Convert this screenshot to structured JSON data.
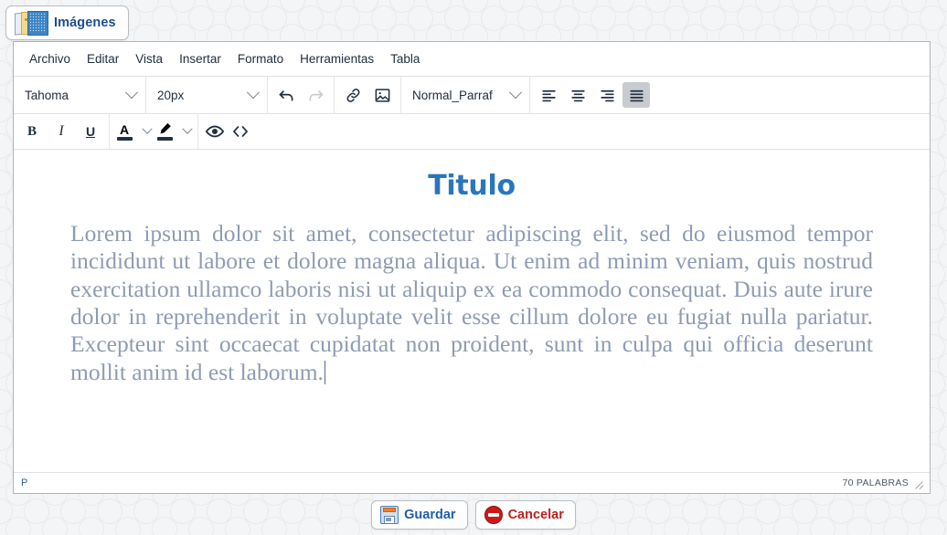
{
  "tab": {
    "label": "Imágenes",
    "icon": "images-stack-icon"
  },
  "menubar": {
    "items": [
      {
        "label": "Archivo"
      },
      {
        "label": "Editar"
      },
      {
        "label": "Vista"
      },
      {
        "label": "Insertar"
      },
      {
        "label": "Formato"
      },
      {
        "label": "Herramientas"
      },
      {
        "label": "Tabla"
      }
    ]
  },
  "toolbar1": {
    "font_family": {
      "value": "Tahoma",
      "icon": "chevron-down-icon"
    },
    "font_size": {
      "value": "20px",
      "icon": "chevron-down-icon"
    },
    "undo": {
      "label": "Deshacer",
      "icon": "undo-icon",
      "state": "enabled"
    },
    "redo": {
      "label": "Rehacer",
      "icon": "redo-icon",
      "state": "disabled"
    },
    "link": {
      "label": "Insertar enlace",
      "icon": "link-icon"
    },
    "image": {
      "label": "Insertar imagen",
      "icon": "image-icon"
    },
    "paragraph_style": {
      "value": "Normal_Parraf",
      "icon": "chevron-down-icon"
    },
    "align_left": {
      "label": "Alinear a la izquierda",
      "icon": "align-left-icon",
      "active": false
    },
    "align_center": {
      "label": "Centrar",
      "icon": "align-center-icon",
      "active": false
    },
    "align_right": {
      "label": "Alinear a la derecha",
      "icon": "align-right-icon",
      "active": false
    },
    "align_justify": {
      "label": "Justificar",
      "icon": "align-justify-icon",
      "active": true
    }
  },
  "toolbar2": {
    "bold": {
      "label": "B",
      "icon": "bold-icon"
    },
    "italic": {
      "label": "I",
      "icon": "italic-icon"
    },
    "underline": {
      "label": "U",
      "icon": "underline-icon"
    },
    "text_color": {
      "label": "A",
      "icon": "text-color-icon",
      "color": "#222f3e"
    },
    "text_color_caret": {
      "icon": "chevron-down-icon"
    },
    "highlight_color": {
      "icon": "highlight-color-icon",
      "color": "#222f3e"
    },
    "highlight_color_caret": {
      "icon": "chevron-down-icon"
    },
    "preview": {
      "label": "Vista previa",
      "icon": "eye-icon"
    },
    "source_code": {
      "label": "Código fuente",
      "icon": "code-icon"
    }
  },
  "document": {
    "title": "Titulo",
    "title_color": "#2a76bd",
    "body": "Lorem ipsum dolor sit amet, consectetur adipiscing elit, sed do eiusmod tempor incididunt ut labore et dolore magna aliqua. Ut enim ad minim veniam, quis nostrud exercitation ullamco laboris nisi ut aliquip ex ea commodo consequat. Duis aute irure dolor in reprehenderit in voluptate velit esse cillum dolore eu fugiat nulla pariatur. Excepteur sint occaecat cupidatat non proident, sunt in culpa qui officia deserunt mollit anim id est laborum.",
    "body_color": "#8f9bb3"
  },
  "statusbar": {
    "element_path": "P",
    "word_count": "70 PALABRAS",
    "resize_handle_icon": "resize-grip-icon"
  },
  "footer": {
    "save": {
      "label": "Guardar",
      "icon": "floppy-disk-icon",
      "color": "#1f5fa8"
    },
    "cancel": {
      "label": "Cancelar",
      "icon": "stop-circle-icon",
      "color": "#c02020"
    }
  }
}
